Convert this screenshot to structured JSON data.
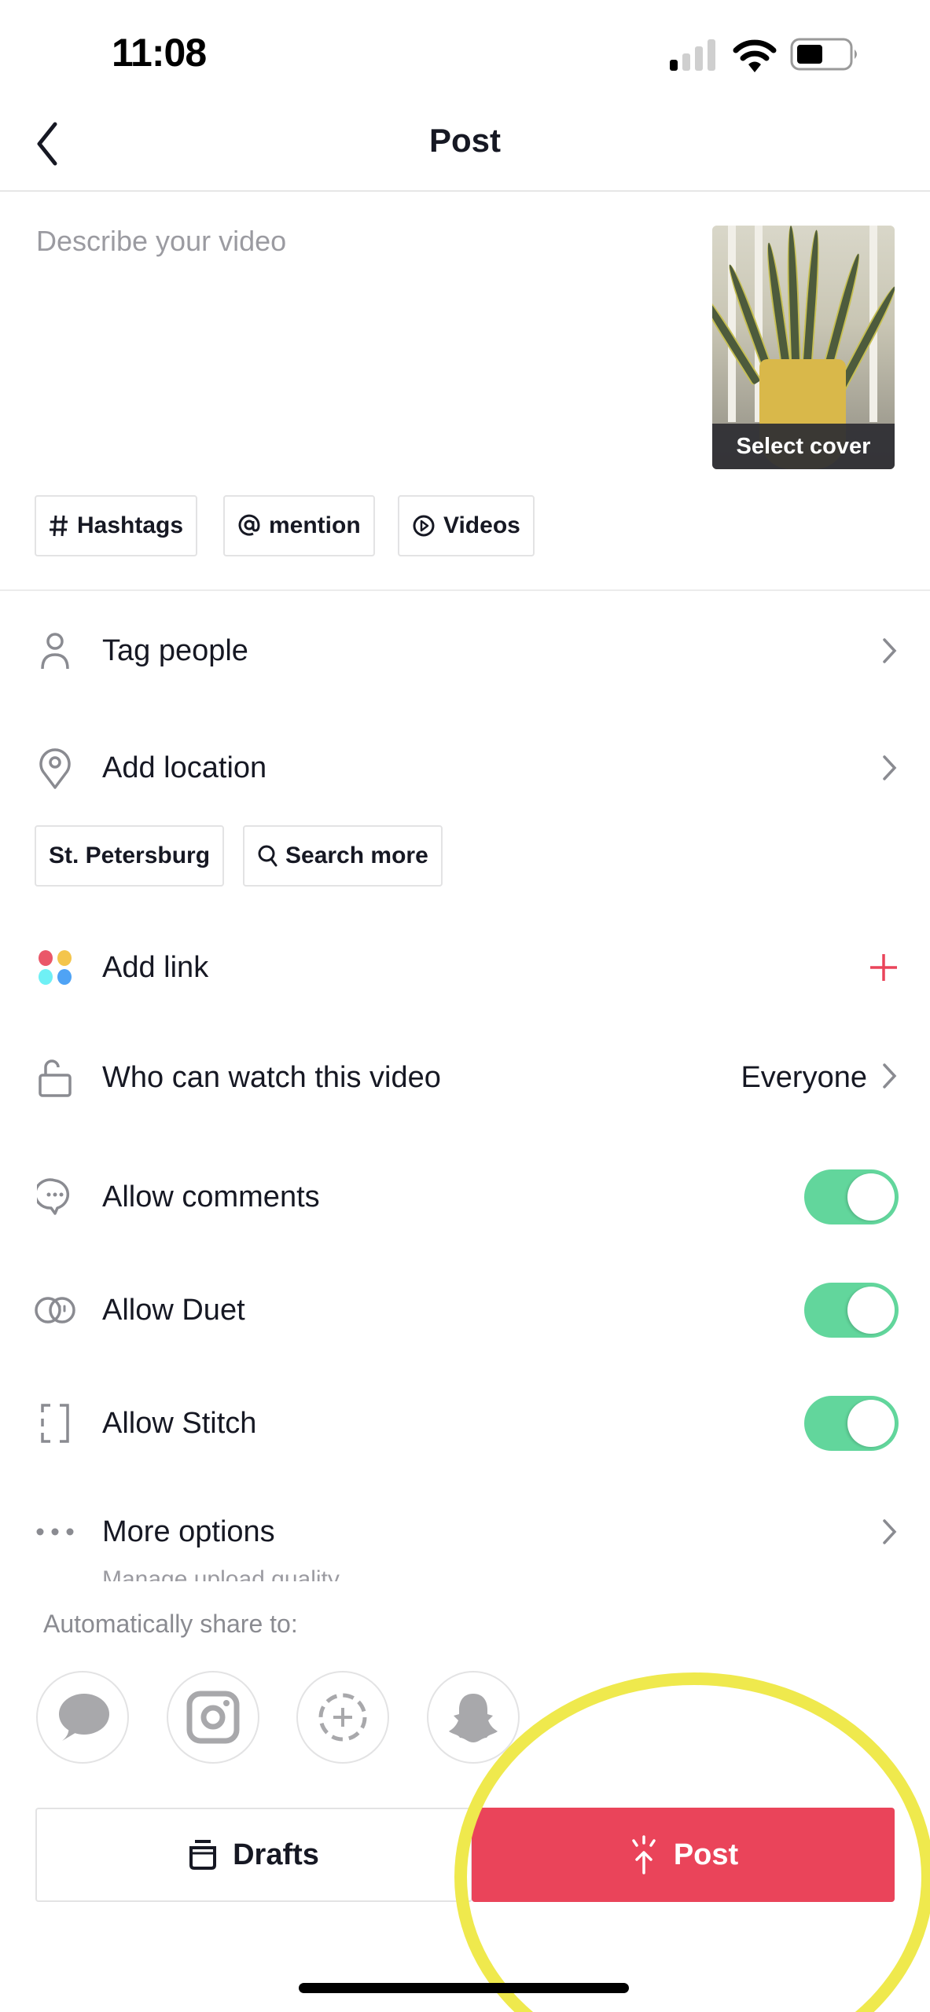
{
  "status_bar": {
    "time": "11:08",
    "signal_icon": "cellular-signal-icon",
    "wifi_icon": "wifi-icon",
    "battery_icon": "battery-icon"
  },
  "nav": {
    "title": "Post",
    "back_icon": "chevron-left-icon"
  },
  "description": {
    "placeholder": "Describe your video",
    "value": ""
  },
  "cover": {
    "label": "Select cover"
  },
  "chips": [
    {
      "icon": "hashtag-icon",
      "label": "Hashtags"
    },
    {
      "icon": "at-sign-icon",
      "label": "mention"
    },
    {
      "icon": "play-circle-icon",
      "label": "Videos"
    }
  ],
  "rows": {
    "tag_people": {
      "icon": "person-icon",
      "label": "Tag people"
    },
    "add_location": {
      "icon": "location-pin-icon",
      "label": "Add location"
    },
    "add_link": {
      "icon": "colored-dots-icon",
      "label": "Add link",
      "action_icon": "plus-icon"
    },
    "who_can_watch": {
      "icon": "unlock-icon",
      "label": "Who can watch this video",
      "value": "Everyone"
    },
    "allow_comments": {
      "icon": "comment-icon",
      "label": "Allow comments",
      "enabled": true
    },
    "allow_duet": {
      "icon": "duet-icon",
      "label": "Allow Duet",
      "enabled": true
    },
    "allow_stitch": {
      "icon": "stitch-icon",
      "label": "Allow Stitch",
      "enabled": true
    },
    "more_options": {
      "icon": "ellipsis-icon",
      "label": "More options",
      "sublabel": "Manage upload quality"
    }
  },
  "location_chips": [
    {
      "label": "St. Petersburg"
    },
    {
      "icon": "search-icon",
      "label": "Search more"
    }
  ],
  "share": {
    "label": "Automatically share to:",
    "targets": [
      {
        "icon": "messages-icon",
        "name": "Messages"
      },
      {
        "icon": "instagram-icon",
        "name": "Instagram"
      },
      {
        "icon": "add-story-icon",
        "name": "Story"
      },
      {
        "icon": "snapchat-icon",
        "name": "Snapchat"
      }
    ]
  },
  "actions": {
    "drafts_label": "Drafts",
    "post_label": "Post"
  },
  "colors": {
    "accent": "#ea445a",
    "toggle_on": "#62d69c",
    "highlight": "#efe94d"
  }
}
